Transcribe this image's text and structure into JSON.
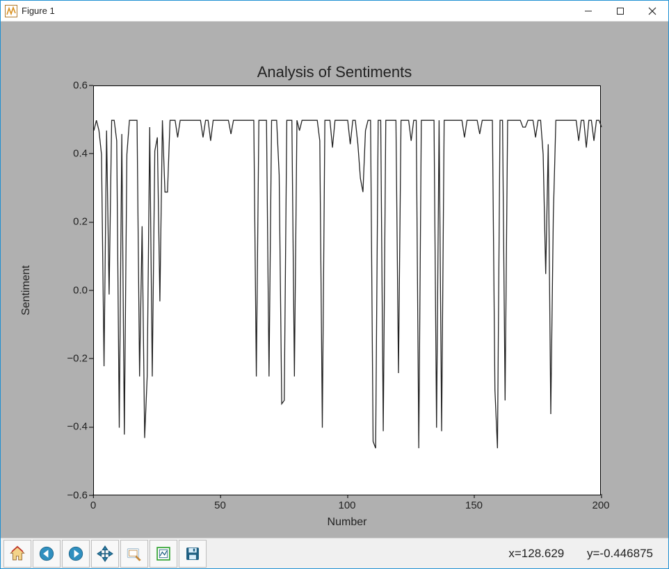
{
  "window": {
    "title": "Figure 1"
  },
  "toolbar": {
    "buttons": [
      {
        "name": "home"
      },
      {
        "name": "back"
      },
      {
        "name": "forward"
      },
      {
        "name": "pan"
      },
      {
        "name": "zoom"
      },
      {
        "name": "configure"
      },
      {
        "name": "save"
      }
    ],
    "cursor_x_label": "x=128.629",
    "cursor_y_label": "y=-0.446875"
  },
  "chart_data": {
    "type": "line",
    "title": "Analysis of Sentiments",
    "xlabel": "Number",
    "ylabel": "Sentiment",
    "xlim": [
      0,
      200
    ],
    "ylim": [
      -0.6,
      0.6
    ],
    "xticks": [
      0,
      50,
      100,
      150,
      200
    ],
    "yticks": [
      -0.6,
      -0.4,
      -0.2,
      0.0,
      0.2,
      0.4,
      0.6
    ],
    "x": [
      0,
      1,
      2,
      3,
      4,
      5,
      6,
      7,
      8,
      9,
      10,
      11,
      12,
      13,
      14,
      15,
      16,
      17,
      18,
      19,
      20,
      21,
      22,
      23,
      24,
      25,
      26,
      27,
      28,
      29,
      30,
      31,
      32,
      33,
      34,
      35,
      36,
      37,
      38,
      39,
      40,
      41,
      42,
      43,
      44,
      45,
      46,
      47,
      48,
      49,
      50,
      51,
      52,
      53,
      54,
      55,
      56,
      57,
      58,
      59,
      60,
      61,
      62,
      63,
      64,
      65,
      66,
      67,
      68,
      69,
      70,
      71,
      72,
      73,
      74,
      75,
      76,
      77,
      78,
      79,
      80,
      81,
      82,
      83,
      84,
      85,
      86,
      87,
      88,
      89,
      90,
      91,
      92,
      93,
      94,
      95,
      96,
      97,
      98,
      99,
      100,
      101,
      102,
      103,
      104,
      105,
      106,
      107,
      108,
      109,
      110,
      111,
      112,
      113,
      114,
      115,
      116,
      117,
      118,
      119,
      120,
      121,
      122,
      123,
      124,
      125,
      126,
      127,
      128,
      129,
      130,
      131,
      132,
      133,
      134,
      135,
      136,
      137,
      138,
      139,
      140,
      141,
      142,
      143,
      144,
      145,
      146,
      147,
      148,
      149,
      150,
      151,
      152,
      153,
      154,
      155,
      156,
      157,
      158,
      159,
      160,
      161,
      162,
      163,
      164,
      165,
      166,
      167,
      168,
      169,
      170,
      171,
      172,
      173,
      174,
      175,
      176,
      177,
      178,
      179,
      180,
      181,
      182,
      183,
      184,
      185,
      186,
      187,
      188,
      189,
      190,
      191,
      192,
      193,
      194,
      195,
      196,
      197,
      198,
      199,
      200
    ],
    "y": [
      0.47,
      0.5,
      0.47,
      0.4,
      -0.22,
      0.47,
      -0.01,
      0.5,
      0.5,
      0.44,
      -0.4,
      0.46,
      -0.42,
      0.4,
      0.5,
      0.5,
      0.5,
      0.5,
      -0.25,
      0.19,
      -0.43,
      -0.25,
      0.48,
      -0.25,
      0.41,
      0.45,
      -0.03,
      0.5,
      0.29,
      0.29,
      0.5,
      0.5,
      0.5,
      0.45,
      0.5,
      0.5,
      0.5,
      0.5,
      0.5,
      0.5,
      0.5,
      0.5,
      0.5,
      0.45,
      0.5,
      0.5,
      0.44,
      0.5,
      0.5,
      0.5,
      0.5,
      0.5,
      0.5,
      0.5,
      0.46,
      0.5,
      0.5,
      0.5,
      0.5,
      0.5,
      0.5,
      0.5,
      0.5,
      0.5,
      -0.25,
      0.5,
      0.5,
      0.5,
      0.5,
      -0.25,
      0.5,
      0.5,
      0.5,
      0.34,
      -0.33,
      -0.32,
      0.5,
      0.5,
      0.5,
      -0.25,
      0.5,
      0.47,
      0.5,
      0.5,
      0.5,
      0.5,
      0.5,
      0.5,
      0.5,
      0.44,
      -0.4,
      0.5,
      0.5,
      0.5,
      0.42,
      0.5,
      0.5,
      0.5,
      0.5,
      0.5,
      0.5,
      0.43,
      0.5,
      0.5,
      0.43,
      0.33,
      0.29,
      0.47,
      0.5,
      0.5,
      -0.44,
      -0.46,
      0.5,
      0.5,
      -0.41,
      0.5,
      0.5,
      0.5,
      0.5,
      0.5,
      -0.24,
      0.5,
      0.5,
      0.5,
      0.5,
      0.44,
      0.5,
      0.5,
      -0.46,
      0.5,
      0.5,
      0.5,
      0.5,
      0.5,
      0.5,
      -0.4,
      0.5,
      -0.41,
      0.5,
      0.5,
      0.5,
      0.5,
      0.5,
      0.5,
      0.5,
      0.5,
      0.45,
      0.5,
      0.5,
      0.5,
      0.5,
      0.5,
      0.46,
      0.5,
      0.5,
      0.5,
      0.5,
      0.5,
      -0.29,
      -0.46,
      0.5,
      0.5,
      -0.32,
      0.5,
      0.5,
      0.5,
      0.5,
      0.5,
      0.5,
      0.48,
      0.48,
      0.5,
      0.5,
      0.5,
      0.45,
      0.5,
      0.5,
      0.4,
      0.05,
      0.43,
      -0.36,
      0.22,
      0.5,
      0.5,
      0.5,
      0.5,
      0.5,
      0.5,
      0.5,
      0.5,
      0.5,
      0.44,
      0.5,
      0.5,
      0.42,
      0.5,
      0.5,
      0.44,
      0.5,
      0.5,
      0.48
    ],
    "series_name": "sentiment",
    "color": "#222222"
  }
}
